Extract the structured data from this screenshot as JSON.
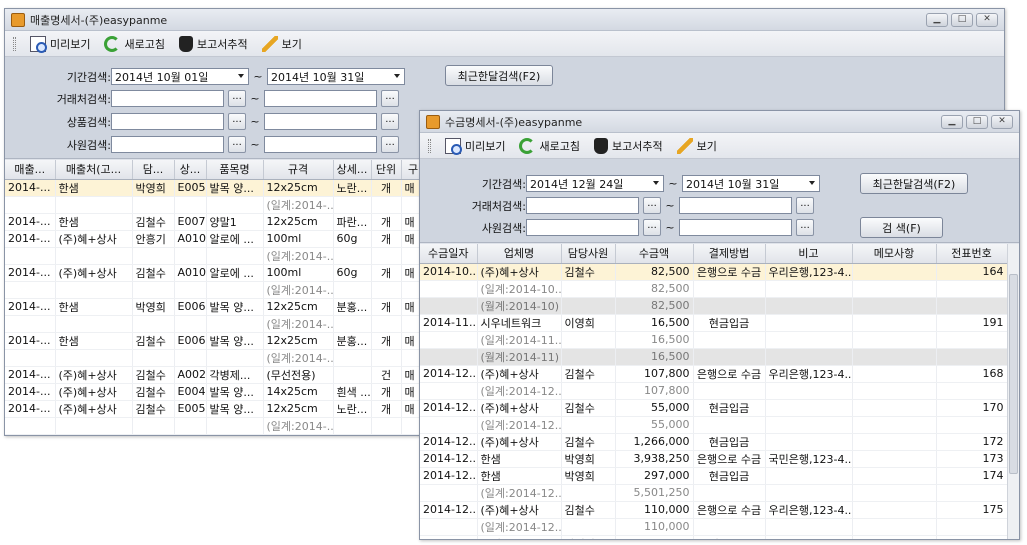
{
  "w1": {
    "title": "매출명세서-(주)easypanme",
    "toolbar": {
      "preview": "미리보기",
      "refresh": "새로고침",
      "trace": "보고서추적",
      "view": "보기"
    },
    "filters": {
      "period_label": "기간검색:",
      "date_from": "2014년 10월 01일",
      "date_to": "2014년 10월 31일",
      "client_label": "거래처검색:",
      "product_label": "상품검색:",
      "staff_label": "사원검색:",
      "tilde": "~",
      "dots": "...",
      "recent_button": "최근한달검색(F2)"
    },
    "columns": [
      "매출...",
      "매출처(고...",
      "담...",
      "상...",
      "품목명",
      "규격",
      "상세...",
      "단위",
      "구"
    ],
    "rows": [
      {
        "t": "hl",
        "c": [
          "2014-...",
          "한샘",
          "박영희",
          "E005",
          "발목 양...",
          "12x25cm",
          "노란...",
          "개",
          "매"
        ]
      },
      {
        "t": "sub",
        "c": [
          "",
          "",
          "",
          "",
          "",
          "(일계:2014-...",
          "",
          "",
          ""
        ]
      },
      {
        "t": "n",
        "c": [
          "2014-...",
          "한샘",
          "김철수",
          "E007",
          "양말1",
          "12x25cm",
          "파란...",
          "개",
          "매"
        ]
      },
      {
        "t": "n",
        "c": [
          "2014-...",
          "(주)혜+상사",
          "안흥기",
          "A010",
          "알로에 ...",
          "100ml",
          "60g",
          "개",
          "매"
        ]
      },
      {
        "t": "sub",
        "c": [
          "",
          "",
          "",
          "",
          "",
          "(일계:2014-...",
          "",
          "",
          ""
        ]
      },
      {
        "t": "n",
        "c": [
          "2014-...",
          "(주)혜+상사",
          "김철수",
          "A010",
          "알로에 ...",
          "100ml",
          "60g",
          "개",
          "매"
        ]
      },
      {
        "t": "sub",
        "c": [
          "",
          "",
          "",
          "",
          "",
          "(일계:2014-...",
          "",
          "",
          ""
        ]
      },
      {
        "t": "n",
        "c": [
          "2014-...",
          "한샘",
          "박영희",
          "E006",
          "발목 양...",
          "12x25cm",
          "분홍...",
          "개",
          "매"
        ]
      },
      {
        "t": "sub",
        "c": [
          "",
          "",
          "",
          "",
          "",
          "(일계:2014-...",
          "",
          "",
          ""
        ]
      },
      {
        "t": "n",
        "c": [
          "2014-...",
          "한샘",
          "김철수",
          "E006",
          "발목 양...",
          "12x25cm",
          "분홍...",
          "개",
          "매"
        ]
      },
      {
        "t": "sub",
        "c": [
          "",
          "",
          "",
          "",
          "",
          "(일계:2014-...",
          "",
          "",
          ""
        ]
      },
      {
        "t": "n",
        "c": [
          "2014-...",
          "(주)혜+상사",
          "김철수",
          "A002",
          "각병제...",
          "(무선전용)",
          "",
          "건",
          "매"
        ]
      },
      {
        "t": "n",
        "c": [
          "2014-...",
          "(주)혜+상사",
          "김철수",
          "E004",
          "발목 양...",
          "14x25cm",
          "흰색 ...",
          "개",
          "매"
        ]
      },
      {
        "t": "n",
        "c": [
          "2014-...",
          "(주)혜+상사",
          "김철수",
          "E005",
          "발목 양...",
          "12x25cm",
          "노란...",
          "개",
          "매"
        ]
      },
      {
        "t": "sub",
        "c": [
          "",
          "",
          "",
          "",
          "",
          "(일계:2014-...",
          "",
          "",
          ""
        ]
      }
    ]
  },
  "w2": {
    "title": "수금명세서-(주)easypanme",
    "toolbar": {
      "preview": "미리보기",
      "refresh": "새로고침",
      "trace": "보고서추적",
      "view": "보기"
    },
    "filters": {
      "period_label": "기간검색:",
      "date_from": "2014년 12월 24일",
      "date_to": "2014년 10월 31일",
      "client_label": "거래처검색:",
      "staff_label": "사원검색:",
      "tilde": "~",
      "dots": "...",
      "recent_button": "최근한달검색(F2)",
      "search_button": "검 색(F)"
    },
    "columns": [
      "수금일자",
      "업체명",
      "담당사원",
      "수금액",
      "결제방법",
      "비고",
      "메모사항",
      "전표번호"
    ],
    "rows": [
      {
        "t": "hl",
        "c": [
          "2014-10...",
          "(주)혜+상사",
          "김철수",
          "82,500",
          "은행으로 수금",
          "우리은행,123-4...",
          "",
          "164"
        ]
      },
      {
        "t": "sub",
        "c": [
          "",
          "(일계:2014-10...",
          "",
          "82,500",
          "",
          "",
          "",
          ""
        ]
      },
      {
        "t": "tot",
        "c": [
          "",
          "(월계:2014-10)",
          "",
          "82,500",
          "",
          "",
          "",
          ""
        ]
      },
      {
        "t": "n",
        "c": [
          "2014-11...",
          "시우네트워크",
          "이영희",
          "16,500",
          "현금입금",
          "",
          "",
          "191"
        ]
      },
      {
        "t": "sub",
        "c": [
          "",
          "(일계:2014-11...",
          "",
          "16,500",
          "",
          "",
          "",
          ""
        ]
      },
      {
        "t": "tot",
        "c": [
          "",
          "(월계:2014-11)",
          "",
          "16,500",
          "",
          "",
          "",
          ""
        ]
      },
      {
        "t": "n",
        "c": [
          "2014-12...",
          "(주)혜+상사",
          "김철수",
          "107,800",
          "은행으로 수금",
          "우리은행,123-4...",
          "",
          "168"
        ]
      },
      {
        "t": "sub",
        "c": [
          "",
          "(일계:2014-12...",
          "",
          "107,800",
          "",
          "",
          "",
          ""
        ]
      },
      {
        "t": "n",
        "c": [
          "2014-12...",
          "(주)혜+상사",
          "김철수",
          "55,000",
          "현금입금",
          "",
          "",
          "170"
        ]
      },
      {
        "t": "sub",
        "c": [
          "",
          "(일계:2014-12...",
          "",
          "55,000",
          "",
          "",
          "",
          ""
        ]
      },
      {
        "t": "n",
        "c": [
          "2014-12...",
          "(주)혜+상사",
          "김철수",
          "1,266,000",
          "현금입금",
          "",
          "",
          "172"
        ]
      },
      {
        "t": "n",
        "c": [
          "2014-12...",
          "한샘",
          "박영희",
          "3,938,250",
          "은행으로 수금",
          "국민은행,123-4...",
          "",
          "173"
        ]
      },
      {
        "t": "n",
        "c": [
          "2014-12...",
          "한샘",
          "박영희",
          "297,000",
          "현금입금",
          "",
          "",
          "174"
        ]
      },
      {
        "t": "sub",
        "c": [
          "",
          "(일계:2014-12...",
          "",
          "5,501,250",
          "",
          "",
          "",
          ""
        ]
      },
      {
        "t": "n",
        "c": [
          "2014-12...",
          "(주)혜+상사",
          "김철수",
          "110,000",
          "은행으로 수금",
          "우리은행,123-4...",
          "",
          "175"
        ]
      },
      {
        "t": "sub",
        "c": [
          "",
          "(일계:2014-12...",
          "",
          "110,000",
          "",
          "",
          "",
          ""
        ]
      },
      {
        "t": "n",
        "c": [
          "2014-12...",
          "한샘",
          "박영희",
          "132,132",
          "현금입금",
          "",
          "",
          "176"
        ]
      }
    ]
  }
}
